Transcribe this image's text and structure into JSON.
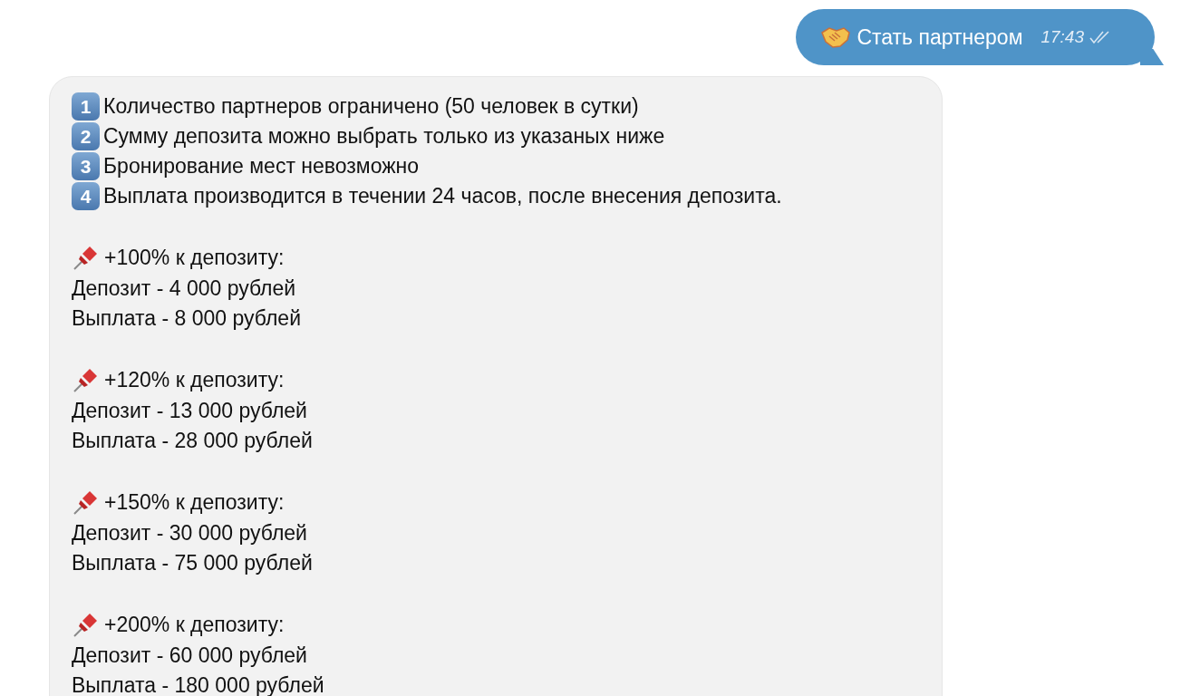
{
  "outgoing": {
    "text": "Стать партнером",
    "time": "17:43",
    "read": true
  },
  "incoming": {
    "rules": [
      {
        "number": "1",
        "text": "Количество партнеров ограничено (50 человек в сутки)"
      },
      {
        "number": "2",
        "text": "Сумму депозита можно выбрать только из указаных ниже"
      },
      {
        "number": "3",
        "text": "Бронирование мест невозможно"
      },
      {
        "number": "4",
        "text": "Выплата производится в течении 24 часов, после внесения депозита."
      }
    ],
    "tiers": [
      {
        "title": "+100% к депозиту:",
        "deposit": "Депозит - 4 000 рублей",
        "payout": "Выплата - 8 000 рублей"
      },
      {
        "title": "+120% к депозиту:",
        "deposit": "Депозит - 13 000 рублей",
        "payout": "Выплата - 28 000 рублей"
      },
      {
        "title": "+150% к депозиту:",
        "deposit": "Депозит - 30 000 рублей",
        "payout": "Выплата - 75 000 рублей"
      },
      {
        "title": "+200% к депозиту:",
        "deposit": "Депозит - 60 000 рублей",
        "payout": "Выплата - 180 000 рублей"
      }
    ]
  }
}
